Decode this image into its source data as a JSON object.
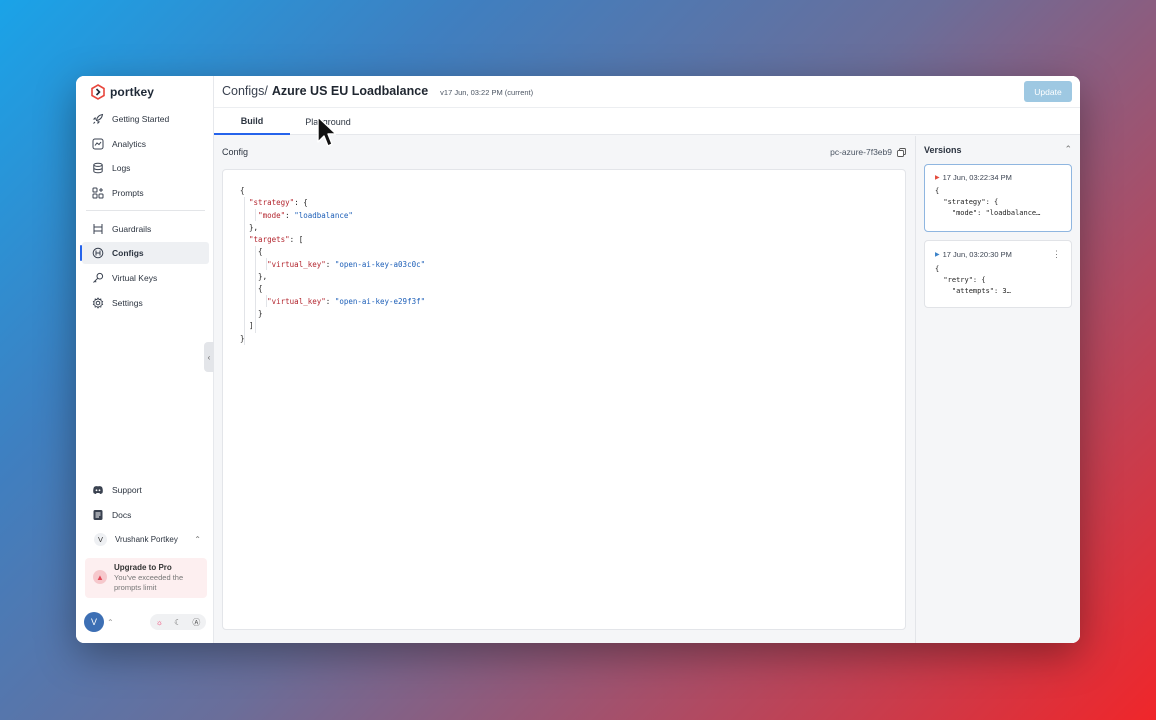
{
  "brand": {
    "name": "portkey"
  },
  "sidebar": {
    "items": [
      {
        "label": "Getting Started",
        "icon": "rocket-icon"
      },
      {
        "label": "Analytics",
        "icon": "analytics-icon"
      },
      {
        "label": "Logs",
        "icon": "database-icon"
      },
      {
        "label": "Prompts",
        "icon": "prompts-icon"
      }
    ],
    "items2": [
      {
        "label": "Guardrails",
        "icon": "guardrails-icon"
      },
      {
        "label": "Configs",
        "icon": "configs-icon",
        "active": true
      },
      {
        "label": "Virtual Keys",
        "icon": "key-icon"
      },
      {
        "label": "Settings",
        "icon": "gear-icon"
      }
    ],
    "bottom": [
      {
        "label": "Support",
        "icon": "discord-icon"
      },
      {
        "label": "Docs",
        "icon": "docs-icon"
      }
    ],
    "user": {
      "initial": "V",
      "name": "Vrushank Portkey"
    },
    "upgrade": {
      "title": "Upgrade to Pro",
      "text_line1": "You've exceeded the",
      "text_line2": "prompts limit"
    },
    "avatar_initial": "V"
  },
  "header": {
    "breadcrumb_parent": "Configs/",
    "title": "Azure US EU Loadbalance",
    "version": "v17 Jun, 03:22 PM (current)",
    "update_label": "Update"
  },
  "tabs": [
    {
      "label": "Build",
      "active": true
    },
    {
      "label": "Playground",
      "active": false
    }
  ],
  "config": {
    "label": "Config",
    "id": "pc-azure-7f3eb9"
  },
  "versions": {
    "title": "Versions",
    "cards": [
      {
        "timestamp": "17 Jun, 03:22:34 PM",
        "lines": [
          "{",
          "  \"strategy\": {",
          "    \"mode\": \"loadbalance…"
        ],
        "selected": true
      },
      {
        "timestamp": "17 Jun, 03:20:30 PM",
        "lines": [
          "{",
          "  \"retry\": {",
          "    \"attempts\": 3…"
        ],
        "selected": false
      }
    ]
  },
  "colors": {
    "accent": "#2563eb",
    "update_button": "#9ec8e2",
    "json_key": "#b3262f",
    "json_string": "#1d5fb8"
  }
}
